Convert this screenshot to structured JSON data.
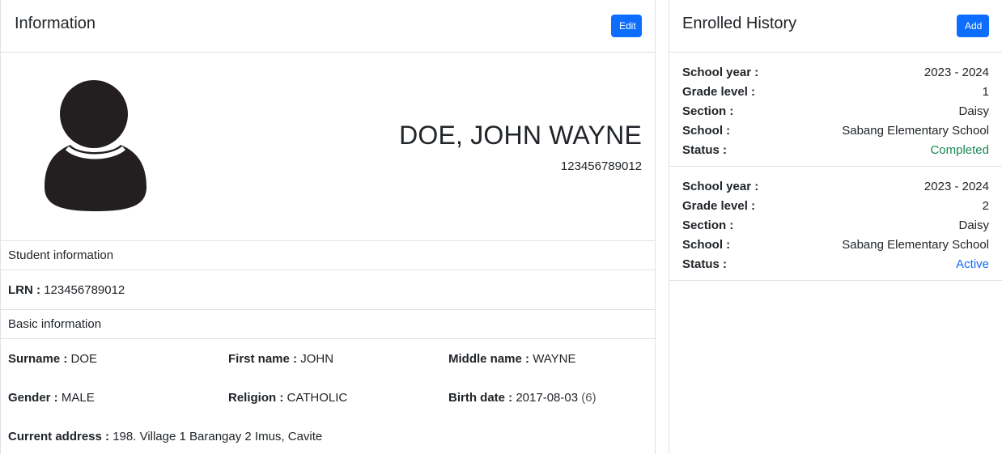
{
  "info": {
    "title": "Information",
    "edit_label": "Edit"
  },
  "student": {
    "full_name": "DOE, JOHN WAYNE",
    "lrn_display": "123456789012"
  },
  "student_information": {
    "heading": "Student information",
    "lrn_label": "LRN :",
    "lrn_value": "123456789012"
  },
  "basic_information": {
    "heading": "Basic information",
    "surname_label": "Surname :",
    "surname_value": "DOE",
    "first_name_label": "First name :",
    "first_name_value": "JOHN",
    "middle_name_label": "Middle name :",
    "middle_name_value": "WAYNE",
    "gender_label": "Gender :",
    "gender_value": "MALE",
    "religion_label": "Religion :",
    "religion_value": "CATHOLIC",
    "birth_date_label": "Birth date :",
    "birth_date_value": "2017-08-03",
    "age_value": "(6)",
    "address_label": "Current address :",
    "address_value": "198. Village 1 Barangay 2 Imus, Cavite"
  },
  "history": {
    "title": "Enrolled History",
    "add_label": "Add",
    "labels": {
      "school_year": "School year :",
      "grade_level": "Grade level :",
      "section": "Section :",
      "school": "School :",
      "status": "Status :"
    },
    "items": [
      {
        "school_year": "2023 - 2024",
        "grade_level": "1",
        "section": "Daisy",
        "school": "Sabang Elementary School",
        "status": "Completed"
      },
      {
        "school_year": "2023 - 2024",
        "grade_level": "2",
        "section": "Daisy",
        "school": "Sabang Elementary School",
        "status": "Active"
      }
    ]
  },
  "colors": {
    "primary": "#0d6efd",
    "success": "#198754",
    "border": "#dee2e6",
    "avatar": "#231f20"
  },
  "icons": {
    "avatar": "user-silhouette-icon"
  }
}
